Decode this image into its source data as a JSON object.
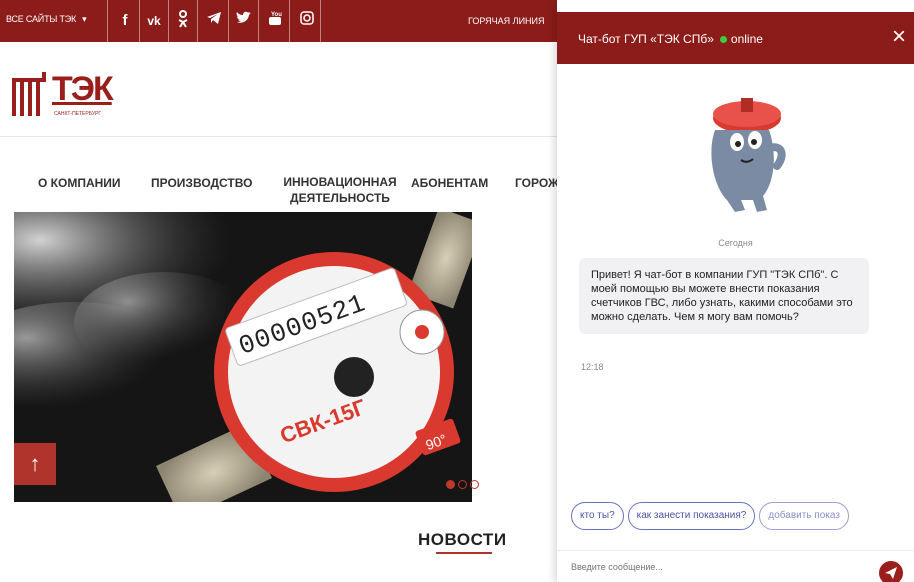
{
  "site": {
    "topbar": {
      "all_sites": "ВСЕ САЙТЫ ТЭК",
      "hotline": "ГОРЯЧАЯ ЛИНИЯ",
      "social_icons": [
        "facebook-icon",
        "vk-icon",
        "odnoklassniki-icon",
        "telegram-icon",
        "twitter-icon",
        "youtube-icon",
        "instagram-icon"
      ]
    },
    "logo": {
      "text": "ТЭК",
      "subtitle": "САНКТ-ПЕТЕРБУРГ"
    },
    "nav": [
      {
        "label": "О КОМПАНИИ"
      },
      {
        "label": "ПРОИЗВОДСТВО"
      },
      {
        "label": "ИННОВАЦИОННАЯ ДЕЯТЕЛЬНОСТЬ"
      },
      {
        "label": "АБОНЕНТАМ"
      },
      {
        "label": "ГОРОЖ"
      }
    ],
    "hero": {
      "counter_digits": "00000521",
      "meter_model": "СВК-15Г",
      "temp_badge": "90°",
      "slides_total": 3,
      "slide_active": 1
    },
    "news_heading": "НОВОСТИ"
  },
  "chat": {
    "title": "Чат-бот ГУП «ТЭК СПб»",
    "status": "online",
    "day_label": "Сегодня",
    "message": "Привет! Я чат-бот в компании ГУП \"ТЭК СПб\". С моей помощью вы можете внести показания счетчиков ГВС, либо узнать, какими способами это можно сделать. Чем я могу вам помочь?",
    "message_time": "12:18",
    "quick_replies": [
      "кто ты?",
      "как занести показания?",
      "добавить показ"
    ],
    "input_placeholder": "Введите сообщение..."
  },
  "colors": {
    "brand": "#8c1c1a",
    "accent": "#b0342c",
    "online": "#3ecc3e",
    "chip": "#6a73c2"
  }
}
